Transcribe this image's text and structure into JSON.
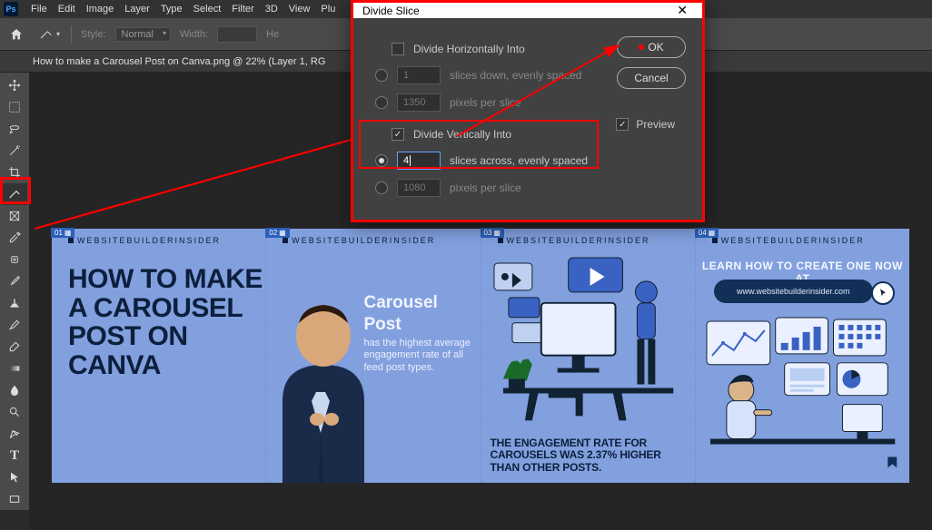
{
  "menu": {
    "items": [
      "File",
      "Edit",
      "Image",
      "Layer",
      "Type",
      "Select",
      "Filter",
      "3D",
      "View",
      "Plu"
    ]
  },
  "optionsbar": {
    "style_label": "Style:",
    "style_value": "Normal",
    "width_label": "Width:",
    "height_label": "He"
  },
  "doctab": {
    "title": "How to make a Carousel Post on Canva.png @ 22% (Layer 1, RG"
  },
  "dialog": {
    "title": "Divide Slice",
    "horiz_label": "Divide Horizontally Into",
    "horiz_checked": false,
    "horiz_count": "1",
    "horiz_count_unit": "slices down, evenly spaced",
    "horiz_px": "1350",
    "horiz_px_unit": "pixels per slice",
    "vert_label": "Divide Vertically Into",
    "vert_checked": true,
    "vert_count": "4",
    "vert_count_unit": "slices across, evenly spaced",
    "vert_px": "1080",
    "vert_px_unit": "pixels per slice",
    "preview_label": "Preview",
    "preview_checked": true,
    "ok": "OK",
    "cancel": "Cancel"
  },
  "canvas": {
    "brand": "WEBSITEBUILDERINSIDER",
    "slices": [
      {
        "badge": "01"
      },
      {
        "badge": "02"
      },
      {
        "badge": "03"
      },
      {
        "badge": "04"
      }
    ],
    "slice1_title": "HOW TO MAKE\nA CAROUSEL\nPOST ON\nCANVA",
    "slice2_heading": "Carousel Post",
    "slice2_body": "has the highest average engagement rate of all feed post types.",
    "slice3_caption": "THE ENGAGEMENT RATE FOR CAROUSELS WAS 2.37% HIGHER THAN OTHER POSTS.",
    "slice4_learn": "LEARN HOW TO CREATE ONE NOW AT",
    "slice4_url": "www.websitebuilderinsider.com"
  }
}
